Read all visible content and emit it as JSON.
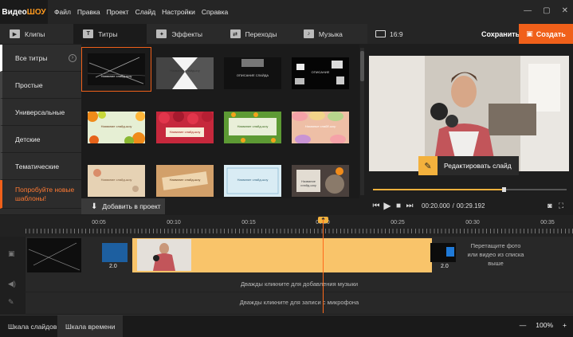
{
  "app": {
    "logo_a": "Видео",
    "logo_b": "ШОУ",
    "menu": [
      "Файл",
      "Правка",
      "Проект",
      "Слайд",
      "Настройки",
      "Справка"
    ]
  },
  "tabs": [
    {
      "label": "Клипы",
      "icon": "clips-icon"
    },
    {
      "label": "Титры",
      "icon": "titles-icon"
    },
    {
      "label": "Эффекты",
      "icon": "effects-icon"
    },
    {
      "label": "Переходы",
      "icon": "transitions-icon"
    },
    {
      "label": "Музыка",
      "icon": "music-icon"
    }
  ],
  "toolbar": {
    "aspect": "16:9",
    "save": "Сохранить",
    "create": "Создать"
  },
  "categories": [
    {
      "label": "Все титры"
    },
    {
      "label": "Простые"
    },
    {
      "label": "Универсальные"
    },
    {
      "label": "Детские"
    },
    {
      "label": "Тематические"
    },
    {
      "label": "Попробуйте новые шаблоны!"
    }
  ],
  "thumbs": [
    {
      "caption": "Название слайд-шоу",
      "theme": "dark-lines"
    },
    {
      "caption": "Название слайдшоу",
      "theme": "white-stripes"
    },
    {
      "caption": "ОПИСАНИЕ СЛАЙДА",
      "theme": "dark-frame"
    },
    {
      "caption": "ОПИСАНИЕ",
      "theme": "dark-blocks"
    },
    {
      "caption": "Название слайд-шоу",
      "theme": "orange-fruits"
    },
    {
      "caption": "Название слайд-шоу",
      "theme": "raspberry"
    },
    {
      "caption": "Название слайд-шоу",
      "theme": "flowers-green"
    },
    {
      "caption": "Название слайд-шоу",
      "theme": "macarons"
    },
    {
      "caption": "Название слайд-шоу",
      "theme": "flowers-paper"
    },
    {
      "caption": "Название слайд-шоу",
      "theme": "wood"
    },
    {
      "caption": "Название слайд-шоу",
      "theme": "light-blue"
    },
    {
      "caption": "Название слайд-шоу",
      "theme": "kitten"
    }
  ],
  "add_to_project": "Добавить в проект",
  "preview": {
    "edit_slide": "Редактировать слайд",
    "progress": 0.676,
    "time_current": "00:20.000",
    "time_separator": "/",
    "time_total": "00:29.192"
  },
  "timeline": {
    "ruler": [
      "00:05",
      "00:10",
      "00:15",
      "00:20",
      "00:25",
      "00:30",
      "00:35"
    ],
    "durations": [
      "2.0",
      "2.0"
    ],
    "hint_drop": "Перетащите фото или видео из списка выше",
    "hint_music": "Дважды кликните для добавления музыки",
    "hint_mic": "Дважды кликните для записи с микрофона"
  },
  "bottom": {
    "tab_slides": "Шкала слайдов",
    "tab_timeline": "Шкала времени",
    "zoom": "100%"
  }
}
